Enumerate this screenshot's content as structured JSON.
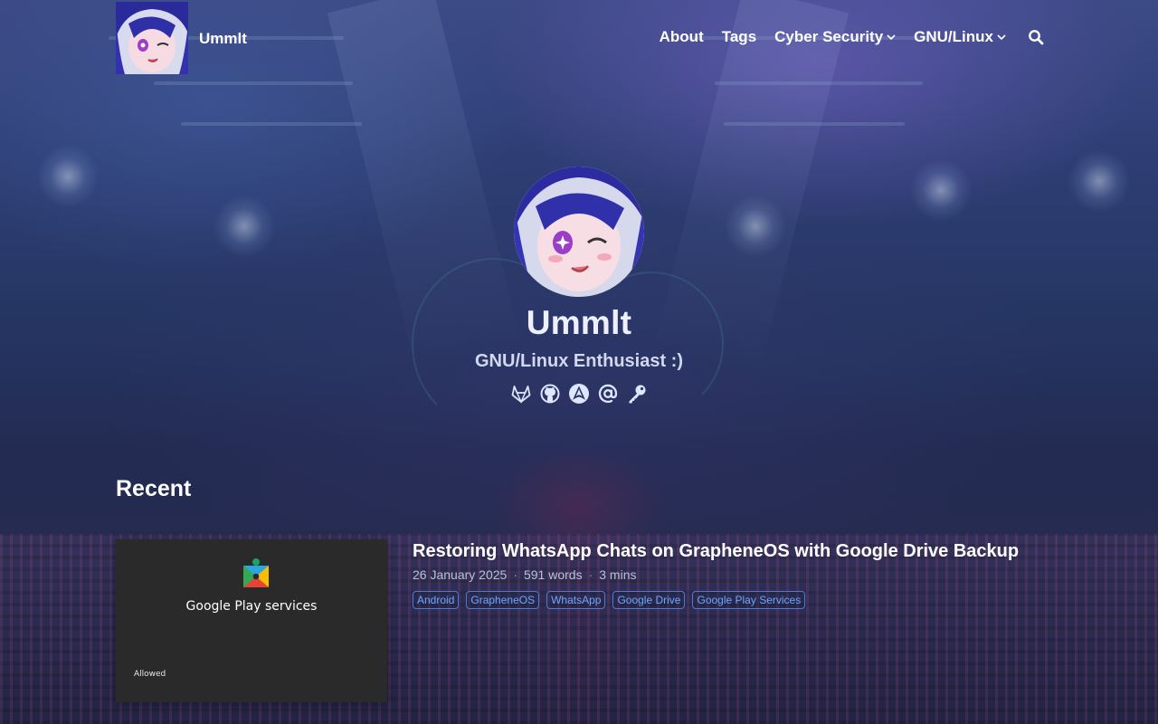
{
  "site": {
    "title": "Ummlt"
  },
  "nav": {
    "items": [
      {
        "label": "About",
        "dropdown": false
      },
      {
        "label": "Tags",
        "dropdown": false
      },
      {
        "label": "Cyber Security",
        "dropdown": true
      },
      {
        "label": "GNU/Linux",
        "dropdown": true
      }
    ],
    "search_icon": "search-icon"
  },
  "hero": {
    "name": "Ummlt",
    "subtitle": "GNU/Linux Enthusiast :)",
    "socials": [
      "gitlab-icon",
      "github-icon",
      "archlinux-icon",
      "email-icon",
      "key-icon"
    ]
  },
  "recent": {
    "heading": "Recent",
    "posts": [
      {
        "title": "Restoring WhatsApp Chats on GrapheneOS with Google Drive Backup",
        "date": "26 January 2025",
        "words": "591 words",
        "read_time": "3 mins",
        "tags": [
          "Android",
          "GrapheneOS",
          "WhatsApp",
          "Google Drive",
          "Google Play Services"
        ],
        "thumbnail": {
          "label": "Google Play services",
          "status": "Allowed",
          "icon": "google-play-services-icon"
        }
      }
    ]
  },
  "colors": {
    "tag_text": "#6aa6ff",
    "tag_border": "#4f78d0",
    "meta_text": "#b9c0d4",
    "thumbnail_bg": "#2a2a2a"
  }
}
